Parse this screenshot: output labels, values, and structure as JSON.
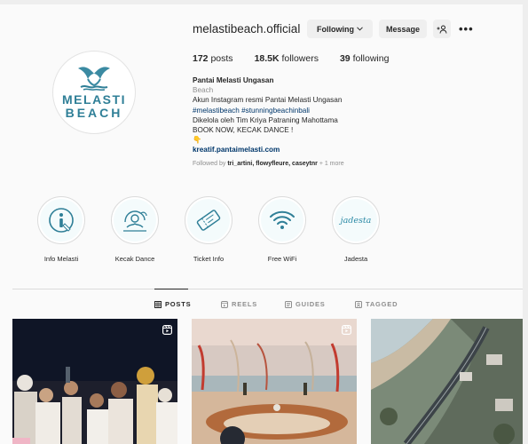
{
  "profile": {
    "username": "melastibeach.official",
    "avatar": {
      "line1": "MELASTI",
      "line2": "BEACH"
    },
    "buttons": {
      "following": "Following",
      "message": "Message"
    },
    "stats": [
      {
        "value": "172",
        "label": "posts"
      },
      {
        "value": "18.5K",
        "label": "followers"
      },
      {
        "value": "39",
        "label": "following"
      }
    ],
    "bio": {
      "name": "Pantai Melasti Ungasan",
      "category": "Beach",
      "line1": "Akun Instagram resmi Pantai Melasti Ungasan",
      "hashtags": "#melastibeach #stunningbeachinbali",
      "line2": "Dikelola oleh Tim Kriya Patraning Mahottama",
      "line3": "BOOK NOW, KECAK DANCE !",
      "emoji": "👇",
      "link": "kreatif.pantaimelasti.com"
    },
    "followed_by": {
      "prefix": "Followed by",
      "names": "tri_artini, flowyfleure, caseytnr",
      "suffix": "+ 1 more"
    }
  },
  "highlights": [
    {
      "label": "Info Melasti",
      "icon": "info-icon"
    },
    {
      "label": "Kecak Dance",
      "icon": "kecak-dancer-icon"
    },
    {
      "label": "Ticket Info",
      "icon": "ticket-icon"
    },
    {
      "label": "Free WiFi",
      "icon": "wifi-icon"
    },
    {
      "label": "Jadesta",
      "icon": "jadesta-logo",
      "text": "jadesta"
    }
  ],
  "tabs": [
    {
      "label": "POSTS",
      "icon": "grid-icon",
      "active": true
    },
    {
      "label": "REELS",
      "icon": "reels-icon",
      "active": false
    },
    {
      "label": "GUIDES",
      "icon": "guides-icon",
      "active": false
    },
    {
      "label": "TAGGED",
      "icon": "tagged-icon",
      "active": false
    }
  ],
  "colors": {
    "link": "#00376b",
    "brand": "#2f7f97",
    "secondary_text": "#8e8e8e",
    "button_bg": "#efefef"
  }
}
